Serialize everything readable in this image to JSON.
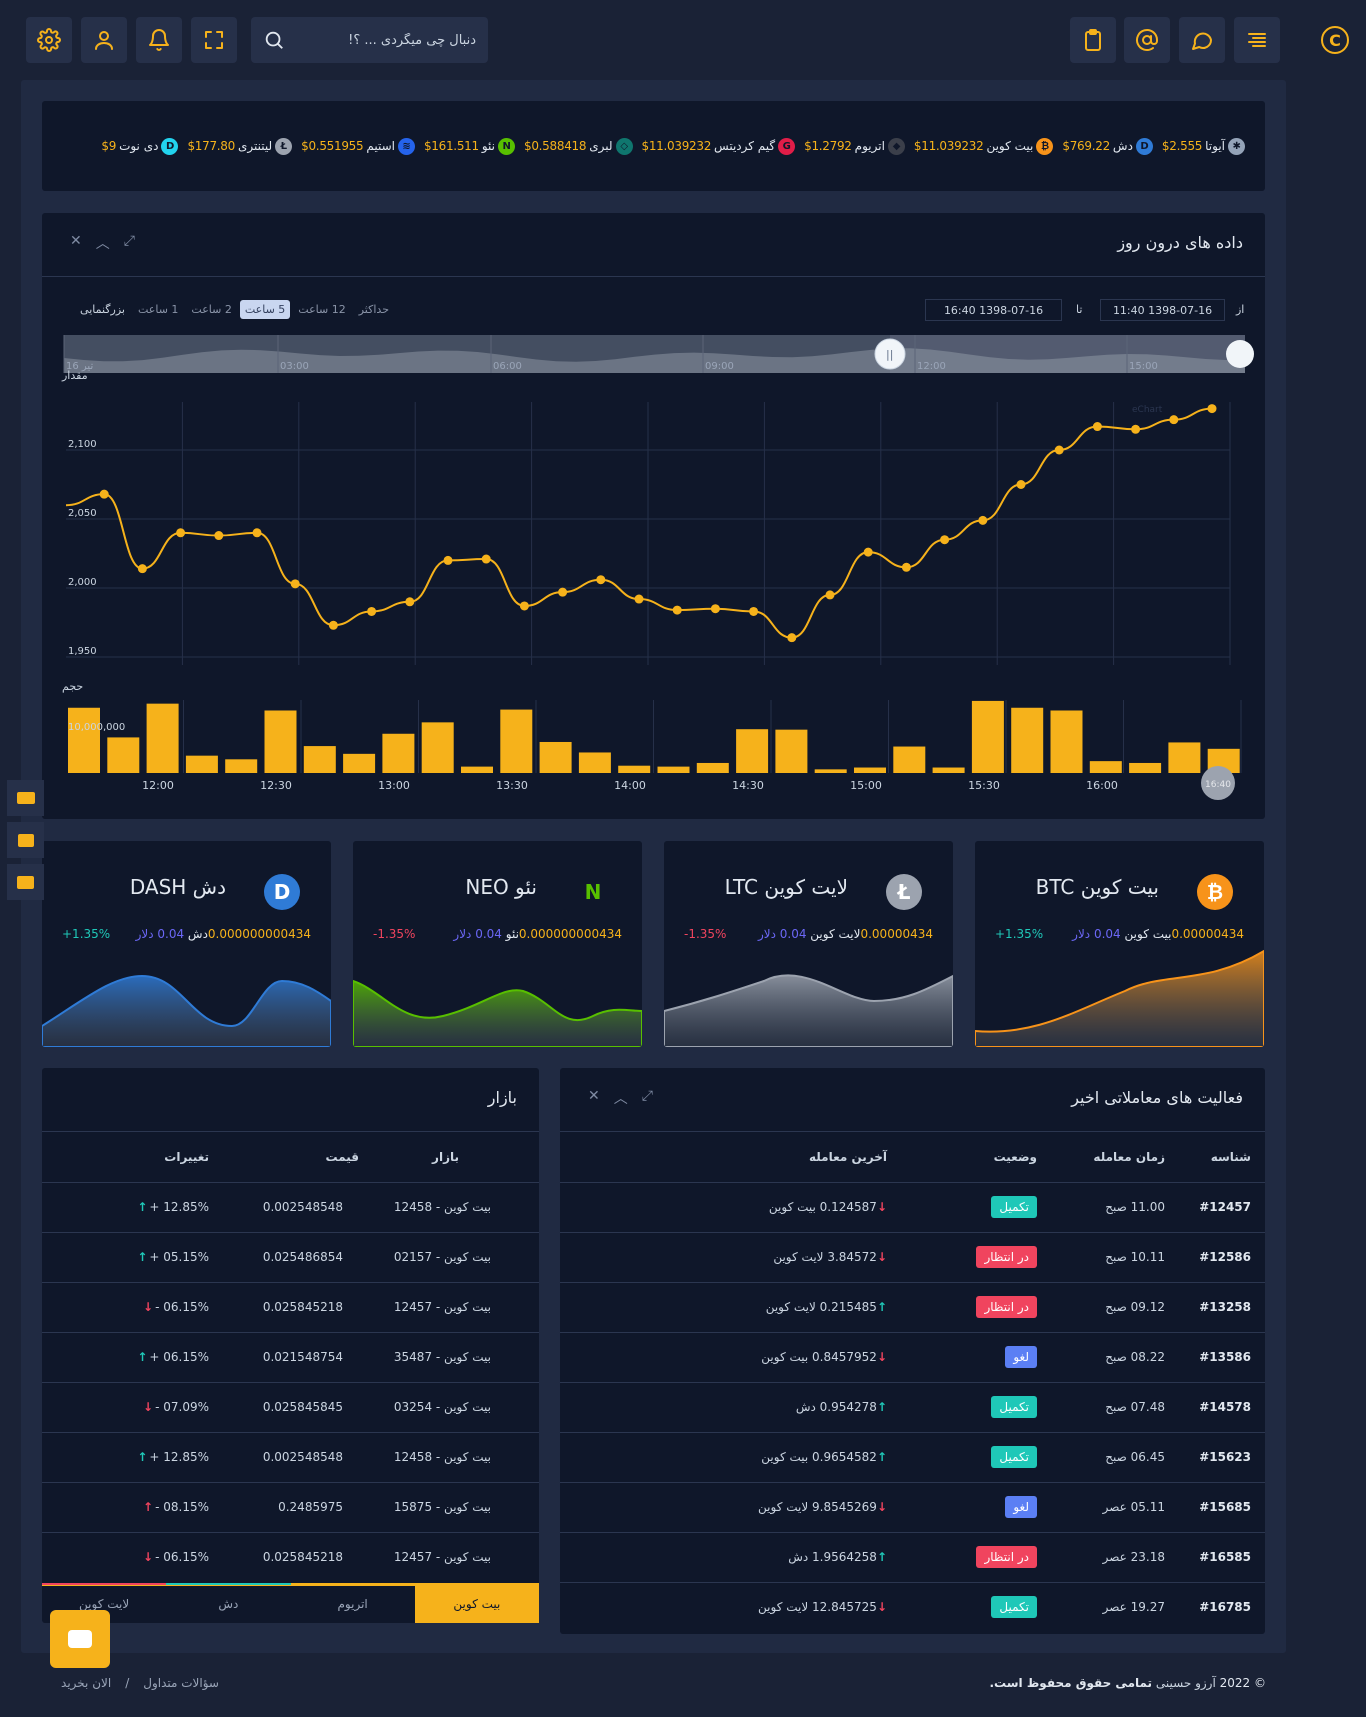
{
  "header": {
    "search_placeholder": "دنبال چی میگردی ... ؟!"
  },
  "ticker": [
    {
      "name": "آیوتا",
      "price": "$2.555",
      "icon": "iota-icon",
      "color": "#94a3b8",
      "glyph": "✱"
    },
    {
      "name": "دش",
      "price": "$769.22",
      "icon": "dash-icon",
      "color": "#2f7bd6",
      "glyph": "D"
    },
    {
      "name": "بیت کوین",
      "price": "$11.039232",
      "icon": "bitcoin-icon",
      "color": "#f7931a",
      "glyph": "₿"
    },
    {
      "name": "اتریوم",
      "price": "$1.2792",
      "icon": "ethereum-icon",
      "color": "#3b3f4a",
      "glyph": "◆"
    },
    {
      "name": "گیم کردیتس",
      "price": "$11.039232",
      "icon": "gamecredits-icon",
      "color": "#e11d48",
      "glyph": "G"
    },
    {
      "name": "لبری",
      "price": "$0.588418",
      "icon": "library-icon",
      "color": "#0f766e",
      "glyph": "◇"
    },
    {
      "name": "نئو",
      "price": "$161.511",
      "icon": "neo-icon",
      "color": "#58bf00",
      "glyph": "N"
    },
    {
      "name": "استیم",
      "price": "$0.551955",
      "icon": "steem-icon",
      "color": "#2563eb",
      "glyph": "≋"
    },
    {
      "name": "لیتنتری",
      "price": "$177.80",
      "icon": "litecoin-icon",
      "color": "#9ca3af",
      "glyph": "Ł"
    },
    {
      "name": "دی نوت",
      "price": "$9",
      "icon": "dnote-icon",
      "color": "#22d3ee",
      "glyph": "D"
    }
  ],
  "intraday": {
    "title": "داده های درون روز",
    "from_label": "از",
    "to_label": "تا",
    "from_value": "11:40 1398-07-16",
    "to_value": "16:40 1398-07-16",
    "zoom_label": "بزرگنمایی",
    "zoom_options": [
      "1 ساعت",
      "2 ساعت",
      "5 ساعت",
      "12 ساعت",
      "حداکثر"
    ],
    "zoom_selected": "5 ساعت",
    "navigator_labels": [
      "تیر 16",
      "03:00",
      "06:00",
      "09:00",
      "12:00",
      "15:00"
    ],
    "price_axis_label": "مقدار",
    "volume_axis_label": "حجم",
    "credit": "eChart",
    "credit_time": "16:40"
  },
  "chart_data": [
    {
      "type": "line",
      "title": "",
      "ylabel": "مقدار",
      "ylim": [
        1950,
        2140
      ],
      "y_ticks": [
        "1,950",
        "2,000",
        "2,050",
        "2,100"
      ],
      "y_tick_values": [
        1950,
        2000,
        2050,
        2100
      ],
      "values": [
        2060,
        2068,
        2014,
        2040,
        2038,
        2040,
        2003,
        1973,
        1983,
        1990,
        2020,
        2021,
        1987,
        1997,
        2006,
        1992,
        1984,
        1985,
        1983,
        1964,
        1995,
        2026,
        2015,
        2035,
        2049,
        2075,
        2100,
        2117,
        2115,
        2122,
        2130
      ],
      "color": "#f6b21b"
    },
    {
      "type": "bar",
      "ylabel": "حجم",
      "y_tick": "10,000,000",
      "x_ticks": [
        "12:00",
        "12:30",
        "13:00",
        "13:30",
        "14:00",
        "14:30",
        "15:00",
        "15:30",
        "16:00"
      ],
      "values": [
        14.3,
        7.8,
        15.2,
        3.8,
        3.0,
        13.7,
        5.9,
        4.2,
        8.6,
        11.1,
        1.4,
        13.9,
        6.8,
        4.5,
        1.6,
        1.4,
        2.2,
        9.6,
        9.5,
        0.8,
        1.2,
        5.8,
        1.2,
        15.8,
        14.3,
        13.7,
        2.6,
        2.2,
        6.7,
        5.3
      ],
      "color": "#f6b21b"
    }
  ],
  "coins": [
    {
      "name": "بیت کوین BTC",
      "amount": "0.00000434",
      "unit": "بیت کوین",
      "usd": "0.04 دلار",
      "change": "+1.35%",
      "positive": true,
      "icon": "bitcoin-icon"
    },
    {
      "name": "لایت کوین LTC",
      "amount": "0.00000434",
      "unit": "لایت کوین",
      "usd": "0.04 دلار",
      "change": "-1.35%",
      "positive": false,
      "icon": "litecoin-icon"
    },
    {
      "name": "نئو NEO",
      "amount": "0.000000000434",
      "unit": "نئو",
      "usd": "0.04 دلار",
      "change": "-1.35%",
      "positive": false,
      "icon": "neo-icon"
    },
    {
      "name": "دش DASH",
      "amount": "0.000000000434",
      "unit": "دش",
      "usd": "0.04 دلار",
      "change": "+1.35%",
      "positive": true,
      "icon": "dash-icon"
    }
  ],
  "activity": {
    "title": "فعالیت های معاملاتی اخیر",
    "columns": [
      "شناسه",
      "زمان معامله",
      "وضعیت",
      "آخرین معامله"
    ],
    "rows": [
      {
        "id": "#12457",
        "time": "11.00 صبح",
        "status": "تکمیل",
        "kind": "done",
        "trade": "0.124587 بیت کوین",
        "up": false
      },
      {
        "id": "#12586",
        "time": "10.11 صبح",
        "status": "در انتظار",
        "kind": "pending",
        "trade": "3.84572 لایت کوین",
        "up": false
      },
      {
        "id": "#13258",
        "time": "09.12 صبح",
        "status": "در انتظار",
        "kind": "pending",
        "trade": "0.215485 لایت کوین",
        "up": true
      },
      {
        "id": "#13586",
        "time": "08.22 صبح",
        "status": "لغو",
        "kind": "cancel",
        "trade": "0.8457952 بیت کوین",
        "up": false
      },
      {
        "id": "#14578",
        "time": "07.48 صبح",
        "status": "تکمیل",
        "kind": "done",
        "trade": "0.954278 دش",
        "up": true
      },
      {
        "id": "#15623",
        "time": "06.45 صبح",
        "status": "تکمیل",
        "kind": "done",
        "trade": "0.9654582 بیت کوین",
        "up": true
      },
      {
        "id": "#15685",
        "time": "05.11 عصر",
        "status": "لغو",
        "kind": "cancel",
        "trade": "9.8545269 لایت کوین",
        "up": false
      },
      {
        "id": "#16585",
        "time": "23.18 عصر",
        "status": "در انتظار",
        "kind": "pending",
        "trade": "1.9564258 دش",
        "up": true
      },
      {
        "id": "#16785",
        "time": "19.27 عصر",
        "status": "تکمیل",
        "kind": "done",
        "trade": "12.845725 لایت کوین",
        "up": false
      }
    ]
  },
  "market": {
    "title": "بازار",
    "columns": [
      "بازار",
      "قیمت",
      "تغییرات"
    ],
    "rows": [
      {
        "market": "بیت کوین - 12458",
        "price": "0.002548548",
        "change": "+ 12.85%",
        "dir": "up-green"
      },
      {
        "market": "بیت کوین - 02157",
        "price": "0.025486854",
        "change": "+ 05.15%",
        "dir": "up-green"
      },
      {
        "market": "بیت کوین - 12457",
        "price": "0.025845218",
        "change": "- 06.15%",
        "dir": "down-red"
      },
      {
        "market": "بیت کوین - 35487",
        "price": "0.021548754",
        "change": "+ 06.15%",
        "dir": "up-green"
      },
      {
        "market": "بیت کوین - 03254",
        "price": "0.025845845",
        "change": "- 07.09%",
        "dir": "down-red"
      },
      {
        "market": "بیت کوین - 12458",
        "price": "0.002548548",
        "change": "+ 12.85%",
        "dir": "up-green"
      },
      {
        "market": "بیت کوین - 15875",
        "price": "0.2485975",
        "change": "- 08.15%",
        "dir": "up-red"
      },
      {
        "market": "بیت کوین - 12457",
        "price": "0.025845218",
        "change": "- 06.15%",
        "dir": "down-red"
      }
    ],
    "tabs": [
      "بیت کوین",
      "اتریوم",
      "دش",
      "لایت کوین"
    ],
    "active_tab": "بیت کوین"
  },
  "footer": {
    "year": "© 2022",
    "author": "آرزو حسینی",
    "rights": "تمامی حقوق محفوظ است.",
    "links": [
      "سؤالات متداول",
      "الان بخرید"
    ],
    "separator": "/"
  },
  "colors": {
    "accent": "#f6b21b",
    "bg": "#1a2236",
    "panel": "#0f172a",
    "done": "#1fc8b8",
    "pending": "#f0445e",
    "cancel": "#5b7ff4"
  }
}
